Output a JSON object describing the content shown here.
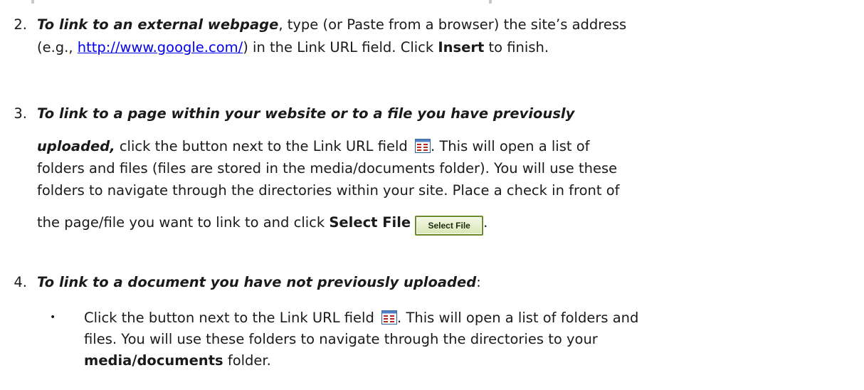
{
  "item2": {
    "number": "2.",
    "bold_lead": "To link to an external webpage",
    "text_a": ", type (or Paste from a browser) the site’s address",
    "text_b_pre": "(e.g., ",
    "link": "http://www.google.com/",
    "text_b_mid": ") in the Link URL field. Click ",
    "bold_insert": "Insert",
    "text_b_post": " to finish."
  },
  "item3": {
    "number": "3.",
    "bold_lead_1": "To link to a page within your website or to a file you have previously",
    "bold_lead_2": "uploaded,",
    "text_a": " click the button next to the Link URL field ",
    "text_a_post": ". This will open a list of",
    "text_b": "folders and files (files are stored in the media/documents folder). You will use these",
    "text_c": "folders to navigate through the directories within your site.  Place a check in front of",
    "text_d_pre": "the page/file you want to link to and click ",
    "bold_select": "Select File",
    "button_label": "Select File",
    "text_d_post": "."
  },
  "item4": {
    "number": "4.",
    "bold_lead": "To link to a document you have not previously uploaded",
    "text_post": ":",
    "bullet": {
      "symbol": "•",
      "text_a_pre": "Click the button next to the Link URL field ",
      "text_a_post": ". This will open a list of folders and",
      "text_b": "files. You will use these folders to navigate through the directories to your",
      "bold_folder": "media/documents",
      "text_c_post": " folder."
    }
  },
  "colors": {
    "link": "#0000ee",
    "text": "#1a1a1a",
    "icon_red": "#b3261e",
    "button_border": "#6c8c2a"
  },
  "icons": {
    "list": "file-list-icon"
  }
}
